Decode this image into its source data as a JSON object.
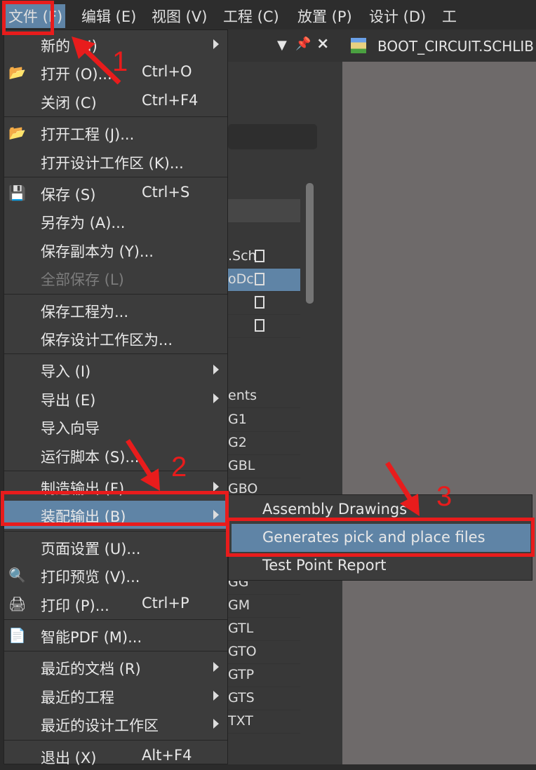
{
  "menubar": {
    "items": [
      "文件 (F)",
      "编辑 (E)",
      "视图 (V)",
      "工程 (C)",
      "放置 (P)",
      "设计 (D)",
      "工"
    ]
  },
  "tab": {
    "title": "BOOT_CIRCUIT.SCHLIB"
  },
  "panel_rows": [
    ".Sch",
    "oDc",
    "",
    "",
    "ents",
    "G1",
    "G2",
    "GBL",
    "GBO",
    "GG",
    "GM",
    "GTL",
    "GTO",
    "GTP",
    "GTS",
    "TXT"
  ],
  "file_menu": [
    {
      "label": "新的 (N)",
      "submenu": true
    },
    {
      "label": "打开 (O)...",
      "shortcut": "Ctrl+O",
      "icon": "folder-open-icon"
    },
    {
      "label": "关闭 (C)",
      "shortcut": "Ctrl+F4"
    },
    {
      "sep": true
    },
    {
      "label": "打开工程 (J)...",
      "icon": "folder-open-icon"
    },
    {
      "label": "打开设计工作区 (K)..."
    },
    {
      "sep": true
    },
    {
      "label": "保存 (S)",
      "shortcut": "Ctrl+S",
      "icon": "save-icon"
    },
    {
      "label": "另存为 (A)..."
    },
    {
      "label": "保存副本为 (Y)..."
    },
    {
      "label": "全部保存 (L)",
      "disabled": true
    },
    {
      "sep": true
    },
    {
      "label": "保存工程为..."
    },
    {
      "label": "保存设计工作区为..."
    },
    {
      "sep": true
    },
    {
      "label": "导入 (I)",
      "submenu": true
    },
    {
      "label": "导出 (E)",
      "submenu": true
    },
    {
      "label": "导入向导"
    },
    {
      "label": "运行脚本 (S)..."
    },
    {
      "sep": true
    },
    {
      "label": "制造输出 (F)",
      "submenu": true
    },
    {
      "label": "装配输出 (B)",
      "submenu": true,
      "highlighted": true
    },
    {
      "sep": true
    },
    {
      "label": "页面设置 (U)..."
    },
    {
      "label": "打印预览 (V)...",
      "icon": "print-preview-icon"
    },
    {
      "label": "打印 (P)...",
      "shortcut": "Ctrl+P",
      "icon": "printer-icon"
    },
    {
      "sep": true
    },
    {
      "label": "智能PDF (M)...",
      "icon": "smart-pdf-icon"
    },
    {
      "sep": true
    },
    {
      "label": "最近的文档 (R)",
      "submenu": true
    },
    {
      "label": "最近的工程",
      "submenu": true
    },
    {
      "label": "最近的设计工作区",
      "submenu": true
    },
    {
      "sep": true
    },
    {
      "label": "退出 (X)",
      "shortcut": "Alt+F4"
    }
  ],
  "assembly_submenu": [
    "Assembly Drawings",
    "Generates pick and place files",
    "Test Point Report"
  ],
  "annotations": {
    "steps": [
      "1",
      "2",
      "3"
    ],
    "color": "#e81c1c"
  },
  "colors": {
    "highlight": "#5f84a6",
    "menu_bg": "#3c3c3c"
  }
}
